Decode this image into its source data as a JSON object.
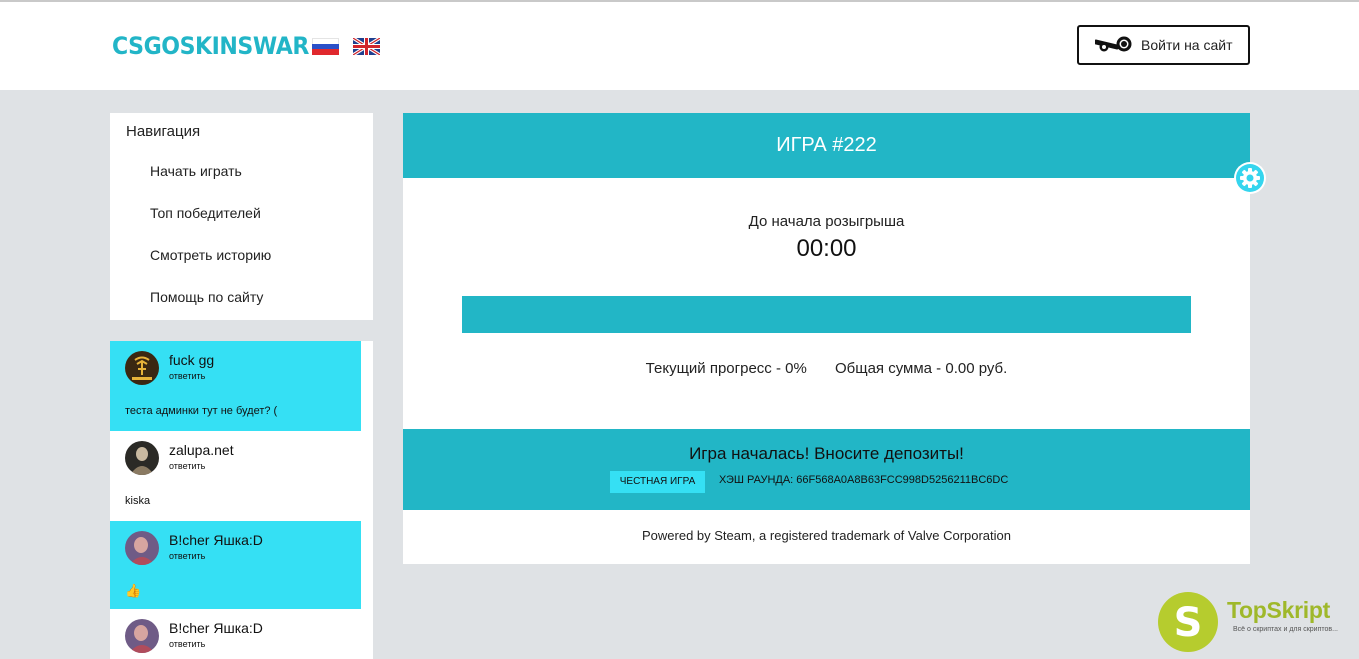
{
  "header": {
    "logo": "CSGOSKINSWAR",
    "login_label": "Войти на сайт"
  },
  "nav": {
    "title": "Навигация",
    "items": [
      {
        "label": "Начать играть"
      },
      {
        "label": "Топ победителей"
      },
      {
        "label": "Смотреть историю"
      },
      {
        "label": "Помощь по сайту"
      }
    ]
  },
  "chat": {
    "messages": [
      {
        "name": "fuck gg",
        "reply": "ответить",
        "text": "теста админки тут не будет? (",
        "highlight": true
      },
      {
        "name": "zalupa.net",
        "reply": "ответить",
        "text": "kiska",
        "highlight": false
      },
      {
        "name": "B!cher Яшка:D",
        "reply": "ответить",
        "text": "👍",
        "highlight": true
      },
      {
        "name": "B!cher Яшка:D",
        "reply": "ответить",
        "text": "",
        "highlight": false
      }
    ]
  },
  "game": {
    "title": "ИГРА #222",
    "countdown_label": "До начала розыгрыша",
    "countdown": "00:00",
    "progress_percent": 0,
    "progress_text": "Текущий прогресс - 0%",
    "total_text": "Общая сумма - 0.00 руб.",
    "status_message": "Игра началась! Вносите депозиты!",
    "fair_label": "ЧЕСТНАЯ ИГРА",
    "hash_text": "ХЭШ РАУНДА: 66F568A0A8B63FCC998D5256211BC6DC",
    "powered_text": "Powered by Steam, a registered trademark of Valve Corporation"
  },
  "watermark": {
    "title": "TopSkript",
    "subtitle": "Всё о скриптах и для скриптов..."
  },
  "colors": {
    "accent": "#22b6c6",
    "highlight": "#35e0f4",
    "background": "#dfe2e5"
  }
}
